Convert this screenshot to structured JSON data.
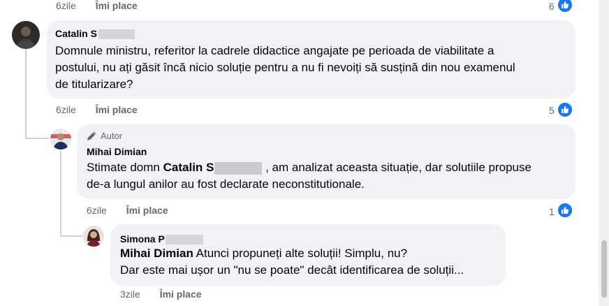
{
  "top_action": {
    "time": "6zile",
    "like": "Îmi place",
    "count": "6"
  },
  "comment1": {
    "author": "Catalin S",
    "text_lines": [
      "Domnule ministru, referitor la cadrele didactice angajate pe perioada de viabilitate a",
      "postului, nu ați găsit încă nicio soluție pentru a nu fi nevoiți să susțină din nou examenul",
      "de titularizare?"
    ],
    "time": "6zile",
    "like": "Îmi place",
    "count": "5"
  },
  "reply1": {
    "badge": "Autor",
    "author": "Mihai Dimian",
    "text_pre": "Stimate domn",
    "mention": "Catalin S",
    "text_post": ", am analizat aceasta situație, dar solutiile propuse",
    "text_line2": "de-a lungul anilor au fost declarate neconstitutionale.",
    "time": "6zile",
    "like": "Îmi place",
    "count": "1"
  },
  "reply2": {
    "author": "Simona P",
    "mention": "Mihai Dimian",
    "text_line1": "Atunci propuneți alte soluții! Simplu, nu?",
    "text_line2": "Dar este mai ușor un \"nu se poate\" decât identificarea de soluții...",
    "time": "3zile",
    "like": "Îmi place"
  },
  "colors": {
    "like_blue": "#1877f2",
    "bubble": "#f0f2f5",
    "meta": "#65676b"
  },
  "icons": [
    "thumbs-up-icon",
    "pencil-icon"
  ]
}
